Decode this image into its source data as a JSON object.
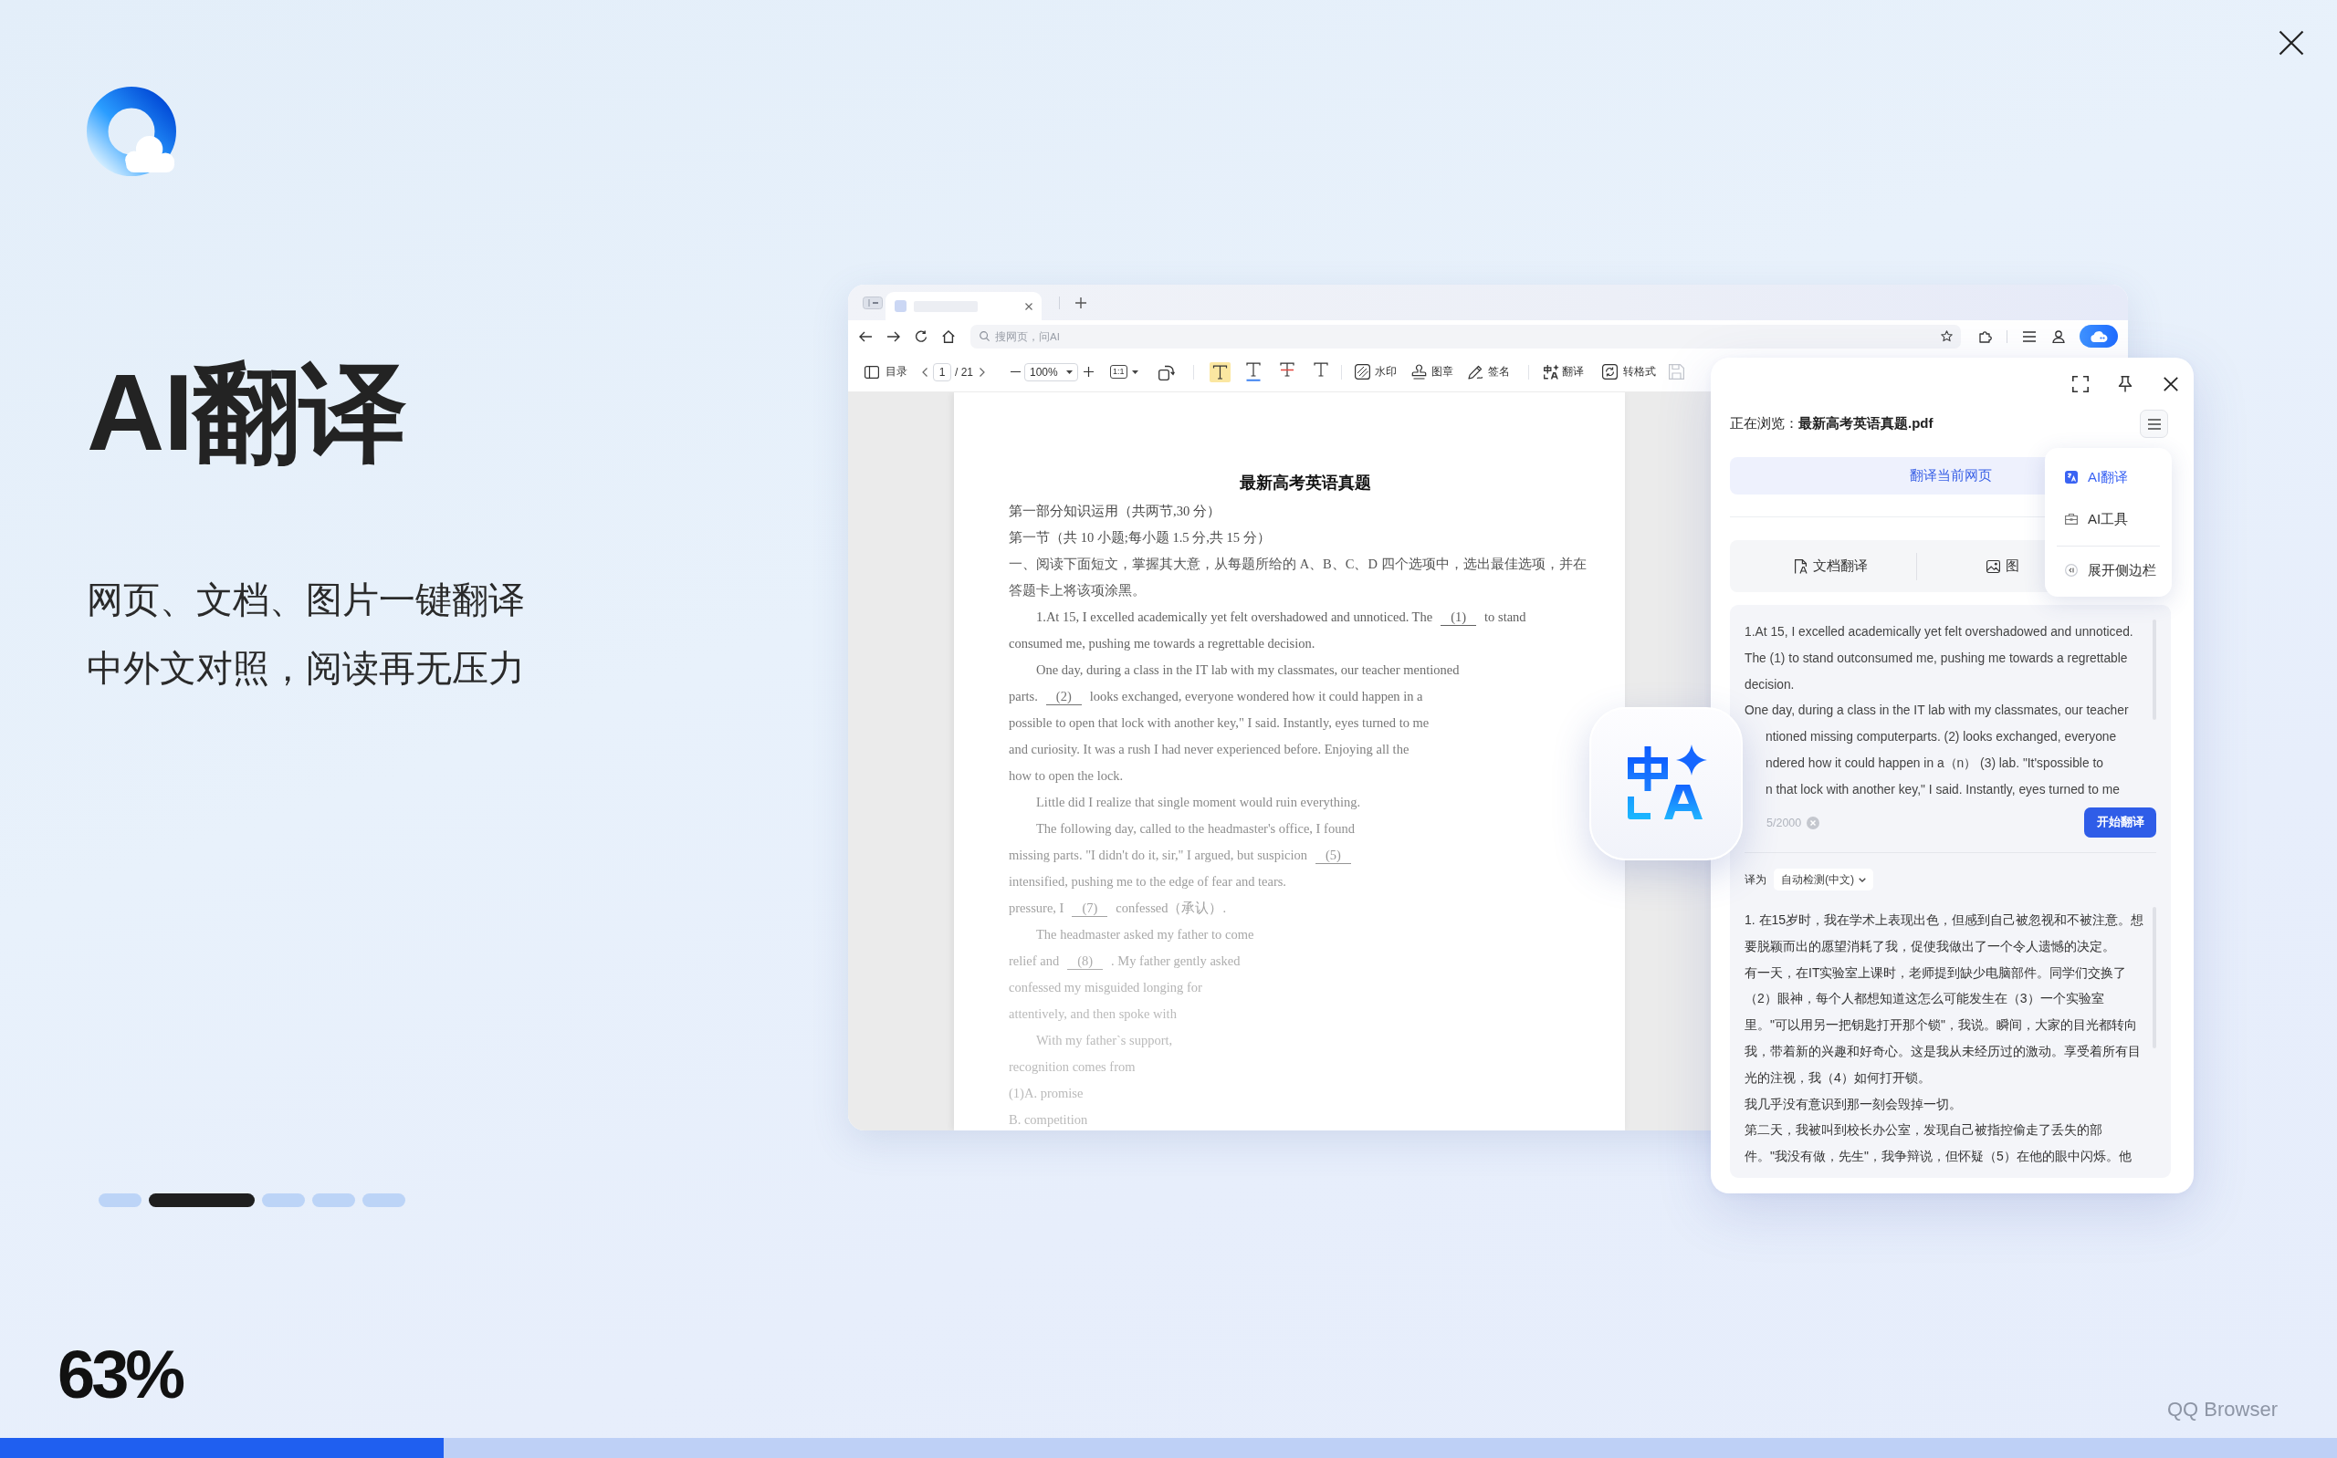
{
  "hero": {
    "title": "AI翻译",
    "subtitle_lines": [
      "网页、文档、图片一键翻译",
      "中外文对照，阅读再无压力"
    ]
  },
  "slide_dots": [
    {
      "selected": false
    },
    {
      "selected": true
    },
    {
      "selected": false
    },
    {
      "selected": false
    },
    {
      "selected": false
    }
  ],
  "loading": {
    "percent": "63%",
    "level": 0.19
  },
  "footer": {
    "brand": "QQ Browser"
  },
  "browser": {
    "address_bar": {
      "placeholder": "搜网页，问AI"
    },
    "pdf_toolbar": {
      "outline_label": "目录",
      "page": "1",
      "page_total": "/ 21",
      "zoom": "100%",
      "fit": "1:1",
      "format_tools": [
        {
          "kind": "highlight"
        },
        {
          "kind": "underline"
        },
        {
          "kind": "strikethrough"
        },
        {
          "kind": "plain"
        }
      ],
      "tools": [
        {
          "label": "水印",
          "kind": "watermark"
        },
        {
          "label": "图章",
          "kind": "stamp"
        },
        {
          "label": "签名",
          "kind": "signature"
        },
        {
          "label": "翻译",
          "kind": "translate"
        },
        {
          "label": "转格式",
          "kind": "convert"
        }
      ]
    },
    "document": {
      "title": "最新高考英语真题",
      "lines": [
        {
          "indent": false,
          "parts": [
            {
              "kind": "text",
              "text": "第一部分知识运用（共两节,30 分）"
            }
          ]
        },
        {
          "indent": false,
          "parts": [
            {
              "kind": "text",
              "text": "第一节（共 10 小题;每小题 1.5 分,共 15 分）"
            }
          ]
        },
        {
          "indent": false,
          "parts": [
            {
              "kind": "text",
              "text": "一、阅读下面短文，掌握其大意，从每题所给的 A、B、C、D 四个选项中，选出最佳选项，并在"
            }
          ]
        },
        {
          "indent": false,
          "parts": [
            {
              "kind": "text",
              "text": "答题卡上将该项涂黑。"
            }
          ]
        },
        {
          "indent": true,
          "parts": [
            {
              "kind": "text",
              "text": "1.At 15, I excelled academically yet felt overshadowed and unnoticed. The"
            },
            {
              "kind": "blank",
              "text": "(1)"
            },
            {
              "kind": "text",
              "text": "to stand"
            }
          ]
        },
        {
          "indent": false,
          "parts": [
            {
              "kind": "text",
              "text": "consumed me, pushing me towards a regrettable decision."
            }
          ]
        },
        {
          "indent": true,
          "parts": [
            {
              "kind": "text",
              "text": "One day, during a class in the IT lab with my classmates, our teacher mentioned"
            }
          ]
        },
        {
          "indent": false,
          "parts": [
            {
              "kind": "text",
              "text": "parts."
            },
            {
              "kind": "blank",
              "text": "(2)"
            },
            {
              "kind": "text",
              "text": "looks exchanged, everyone wondered how it could happen in a"
            }
          ]
        },
        {
          "indent": false,
          "parts": [
            {
              "kind": "text",
              "text": "possible to open that lock with another key,\" I said. Instantly, eyes turned to me"
            }
          ]
        },
        {
          "indent": false,
          "parts": [
            {
              "kind": "text",
              "text": "and curiosity. It was a rush I had never experienced before. Enjoying all the"
            }
          ]
        },
        {
          "indent": false,
          "parts": [
            {
              "kind": "text",
              "text": "how to open the lock."
            }
          ]
        },
        {
          "indent": true,
          "parts": [
            {
              "kind": "text",
              "text": "Little did I realize that single moment would ruin everything."
            }
          ]
        },
        {
          "indent": true,
          "parts": [
            {
              "kind": "text",
              "text": "The following day, called to the headmaster's office, I found"
            }
          ]
        },
        {
          "indent": false,
          "parts": [
            {
              "kind": "text",
              "text": "missing parts. \"I didn't do it, sir,\" I argued, but suspicion"
            },
            {
              "kind": "blank",
              "text": "(5)"
            }
          ]
        },
        {
          "indent": false,
          "parts": [
            {
              "kind": "text",
              "text": "intensified, pushing me to the edge of fear and tears."
            }
          ]
        },
        {
          "indent": false,
          "parts": [
            {
              "kind": "text",
              "text": "pressure, I"
            },
            {
              "kind": "blank",
              "text": "(7)"
            },
            {
              "kind": "text",
              "text": "confessed（承认）."
            }
          ]
        },
        {
          "indent": true,
          "parts": [
            {
              "kind": "text",
              "text": "The headmaster asked my father to come"
            }
          ]
        },
        {
          "indent": false,
          "parts": [
            {
              "kind": "text",
              "text": "relief and"
            },
            {
              "kind": "blank",
              "text": "(8)"
            },
            {
              "kind": "text",
              "text": ". My father gently asked"
            }
          ]
        },
        {
          "indent": false,
          "parts": [
            {
              "kind": "text",
              "text": "confessed my misguided longing for"
            }
          ]
        },
        {
          "indent": false,
          "parts": [
            {
              "kind": "text",
              "text": "attentively, and then spoke with"
            }
          ]
        },
        {
          "indent": true,
          "parts": [
            {
              "kind": "text",
              "text": "With my father`s support,"
            }
          ]
        },
        {
          "indent": false,
          "parts": [
            {
              "kind": "text",
              "text": "recognition comes from"
            }
          ]
        },
        {
          "indent": false,
          "parts": [
            {
              "kind": "text",
              "text": "(1)A. promise"
            }
          ]
        },
        {
          "indent": false,
          "parts": [
            {
              "kind": "text",
              "text": "B. competition"
            }
          ]
        }
      ]
    }
  },
  "side_panel": {
    "browsing_title": "正在浏览：**最新高考英语真题.pdf**",
    "translate_page_button": "翻译当前网页",
    "mode_tabs": [
      {
        "label": "文档翻译",
        "kind": "document"
      },
      {
        "label": "图",
        "kind": "image"
      }
    ],
    "menu": {
      "items": [
        {
          "label": "AI翻译",
          "kind": "translate",
          "selected": true
        },
        {
          "label": "AI工具",
          "kind": "tools",
          "selected": false
        },
        {
          "label": "展开侧边栏",
          "kind": "expand",
          "selected": false
        }
      ]
    },
    "source": {
      "lines": [
        {
          "text": "1.At 15, I excelled academically yet felt overshadowed and unnoticed.",
          "covered": false
        },
        {
          "text": "The (1) to stand outconsumed me, pushing me towards a regrettable",
          "covered": false
        },
        {
          "text": "decision.",
          "covered": false
        },
        {
          "text": "One day, during a class in the IT lab with my classmates, our teacher",
          "covered": false
        },
        {
          "text": "ntioned missing computerparts. (2) looks exchanged, everyone",
          "covered": true
        },
        {
          "text": "ndered how it could happen in a（n） (3) lab. \"It'spossible to",
          "covered": true
        },
        {
          "text": "n that lock with another key,\" I said. Instantly, eyes turned to me",
          "covered": true
        }
      ],
      "counter": "5/2000",
      "submit_button": "开始翻译"
    },
    "target_language": {
      "label": "译为",
      "value": "自动检测(中文)"
    },
    "translation": {
      "lines": [
        "1. 在15岁时，我在学术上表现出色，但感到自己被忽视和不被注意。想",
        "要脱颖而出的愿望消耗了我，促使我做出了一个令人遗憾的决定。",
        "有一天，在IT实验室上课时，老师提到缺少电脑部件。同学们交换了",
        "（2）眼神，每个人都想知道这怎么可能发生在（3）一个实验室",
        "里。\"可以用另一把钥匙打开那个锁\"，我说。瞬间，大家的目光都转向",
        "我，带着新的兴趣和好奇心。这是我从未经历过的激动。享受着所有目",
        "光的注视，我（4）如何打开锁。",
        "我几乎没有意识到那一刻会毁掉一切。",
        "第二天，我被叫到校长办公室，发现自己被指控偷走了丢失的部",
        "件。\"我没有做，先生\"，我争辩说，但怀疑（5）在他的眼中闪烁。他"
      ]
    }
  }
}
